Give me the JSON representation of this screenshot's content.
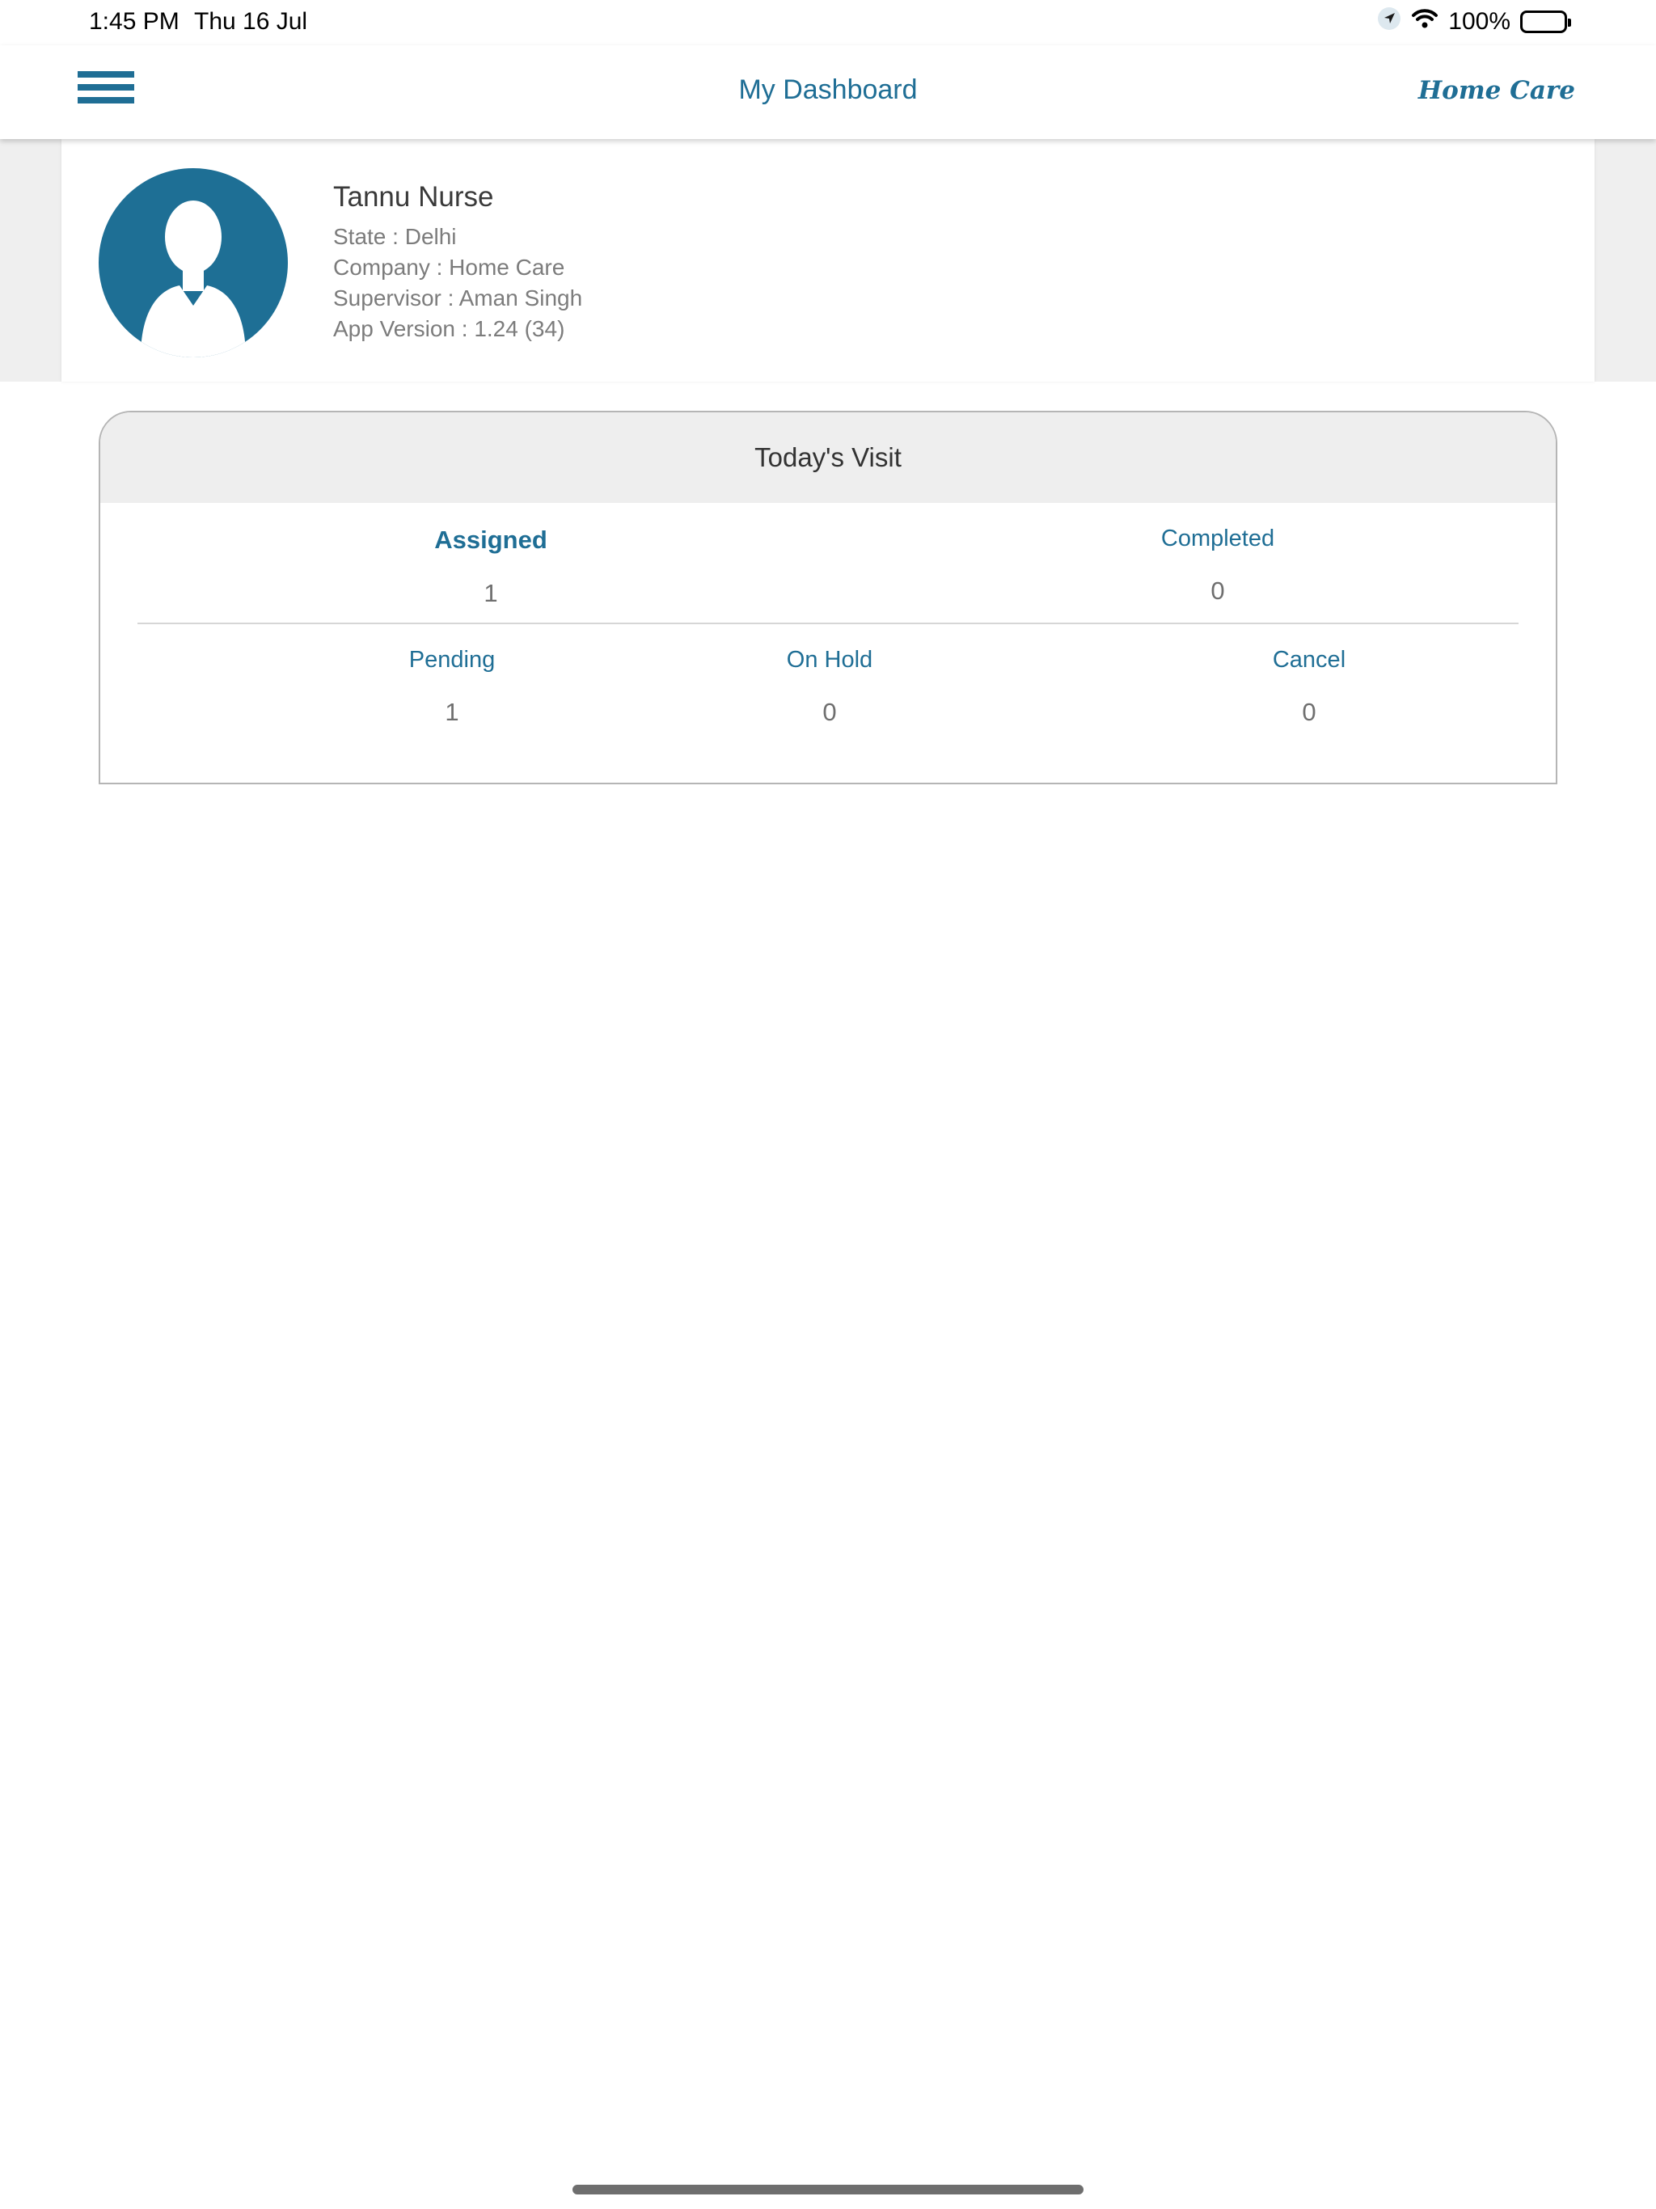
{
  "status_bar": {
    "time": "1:45 PM",
    "date": "Thu 16 Jul",
    "battery": "100%",
    "icons": [
      "location-icon",
      "wifi-icon",
      "battery-icon"
    ]
  },
  "navbar": {
    "title": "My Dashboard",
    "brand": "Home Care",
    "menu_icon": "hamburger-menu-icon"
  },
  "profile": {
    "name": "Tannu Nurse",
    "state": "State : Delhi",
    "company": "Company : Home Care",
    "supervisor": "Supervisor : Aman Singh",
    "app_version": "App Version :  1.24 (34)",
    "avatar_icon": "user-avatar-icon"
  },
  "visits": {
    "title": "Today's Visit",
    "assigned": {
      "label": "Assigned",
      "value": "1"
    },
    "completed": {
      "label": "Completed",
      "value": "0"
    },
    "pending": {
      "label": "Pending",
      "value": "1"
    },
    "on_hold": {
      "label": "On Hold",
      "value": "0"
    },
    "cancel": {
      "label": "Cancel",
      "value": "0"
    }
  },
  "colors": {
    "accent": "#1f6e95",
    "header_bg": "#eeeeee",
    "band_bg": "#efefef"
  }
}
